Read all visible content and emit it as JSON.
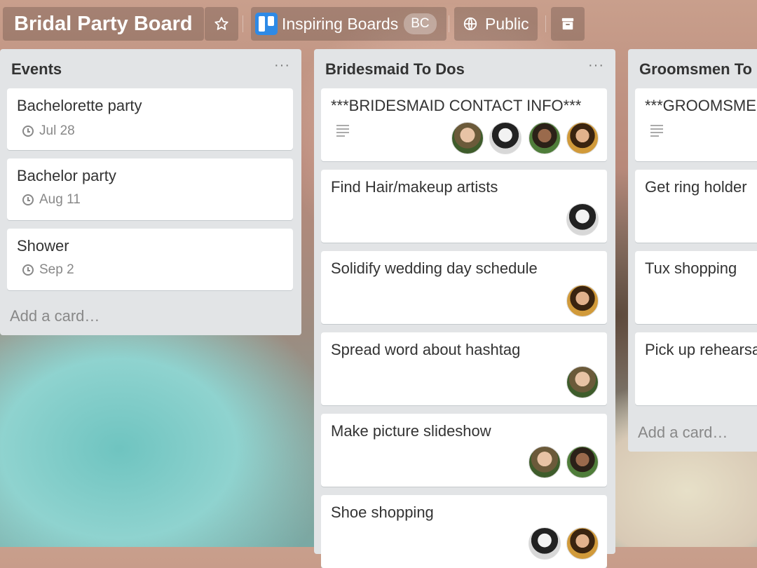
{
  "header": {
    "board_title": "Bridal Party Board",
    "star_icon": "star-icon",
    "team_name": "Inspiring Boards",
    "team_badge": "BC",
    "visibility": "Public",
    "visibility_icon": "globe-icon",
    "archive_icon": "archive-icon"
  },
  "lists": [
    {
      "title": "Events",
      "menu": "···",
      "cards": [
        {
          "title": "Bachelorette party",
          "due": "Jul 28"
        },
        {
          "title": "Bachelor party",
          "due": "Aug 11"
        },
        {
          "title": "Shower",
          "due": "Sep 2"
        }
      ],
      "add_card": "Add a card…"
    },
    {
      "title": "Bridesmaid To Dos",
      "menu": "···",
      "cards": [
        {
          "title": "***BRIDESMAID CONTACT INFO***",
          "has_description": true,
          "members": [
            "a",
            "b",
            "c",
            "d"
          ]
        },
        {
          "title": "Find Hair/makeup artists",
          "members": [
            "b"
          ]
        },
        {
          "title": "Solidify wedding day schedule",
          "members": [
            "d"
          ]
        },
        {
          "title": "Spread word about hashtag",
          "members": [
            "a"
          ]
        },
        {
          "title": "Make picture slideshow",
          "members": [
            "a",
            "c"
          ]
        },
        {
          "title": "Shoe shopping",
          "members": [
            "b",
            "d"
          ]
        }
      ]
    },
    {
      "title": "Groomsmen To",
      "cards": [
        {
          "title": "***GROOMSMEN",
          "has_description": true
        },
        {
          "title": "Get ring holder"
        },
        {
          "title": "Tux shopping"
        },
        {
          "title": "Pick up rehearsa"
        }
      ],
      "add_card": "Add a card…"
    }
  ]
}
